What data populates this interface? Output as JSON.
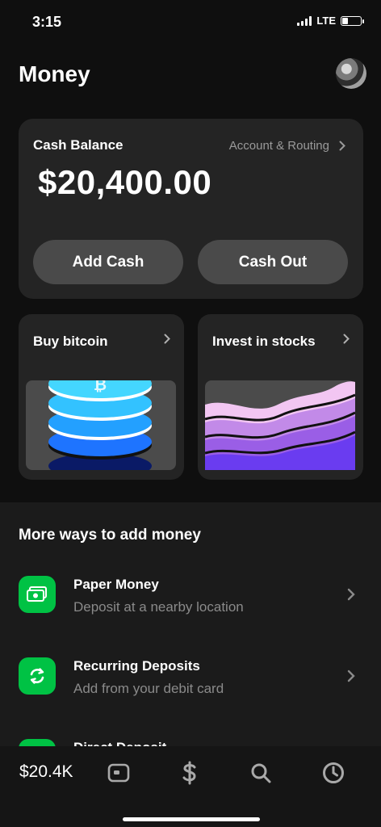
{
  "status_bar": {
    "time": "3:15",
    "network": "LTE"
  },
  "header": {
    "title": "Money"
  },
  "cash_card": {
    "label": "Cash Balance",
    "routing_link": "Account & Routing",
    "balance": "$20,400.00",
    "add_cash": "Add Cash",
    "cash_out": "Cash Out"
  },
  "tiles": [
    {
      "title": "Buy bitcoin"
    },
    {
      "title": "Invest in stocks"
    }
  ],
  "more_ways": {
    "title": "More ways to add money",
    "items": [
      {
        "title": "Paper Money",
        "subtitle": "Deposit at a nearby location",
        "icon": "cash-icon"
      },
      {
        "title": "Recurring Deposits",
        "subtitle": "Add from your debit card",
        "icon": "recurring-icon"
      },
      {
        "title": "Direct Deposit",
        "subtitle": "",
        "icon": "direct-deposit-icon"
      }
    ]
  },
  "tab_bar": {
    "balance_label": "$20.4K",
    "icons": [
      "card-icon",
      "dollar-icon",
      "search-icon",
      "clock-icon"
    ]
  },
  "colors": {
    "accent": "#00c244",
    "background": "#0f0f0f",
    "card": "#242424"
  }
}
